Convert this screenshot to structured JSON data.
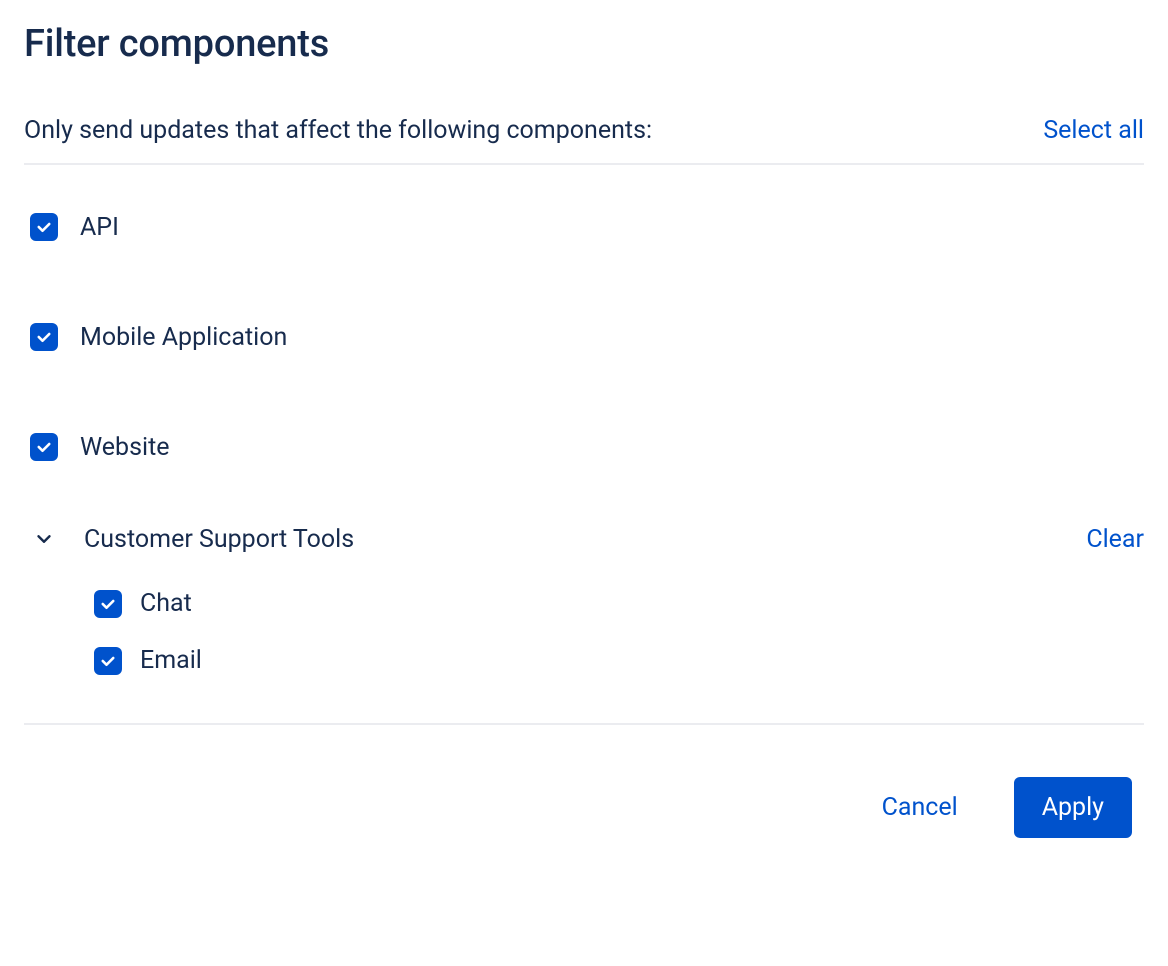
{
  "dialog": {
    "title": "Filter components",
    "subheader": "Only send updates that affect the following components:",
    "select_all_label": "Select all"
  },
  "components": [
    {
      "label": "API",
      "checked": true
    },
    {
      "label": "Mobile Application",
      "checked": true
    },
    {
      "label": "Website",
      "checked": true
    }
  ],
  "group": {
    "label": "Customer Support Tools",
    "expanded": true,
    "clear_label": "Clear",
    "children": [
      {
        "label": "Chat",
        "checked": true
      },
      {
        "label": "Email",
        "checked": true
      }
    ]
  },
  "footer": {
    "cancel_label": "Cancel",
    "apply_label": "Apply"
  }
}
